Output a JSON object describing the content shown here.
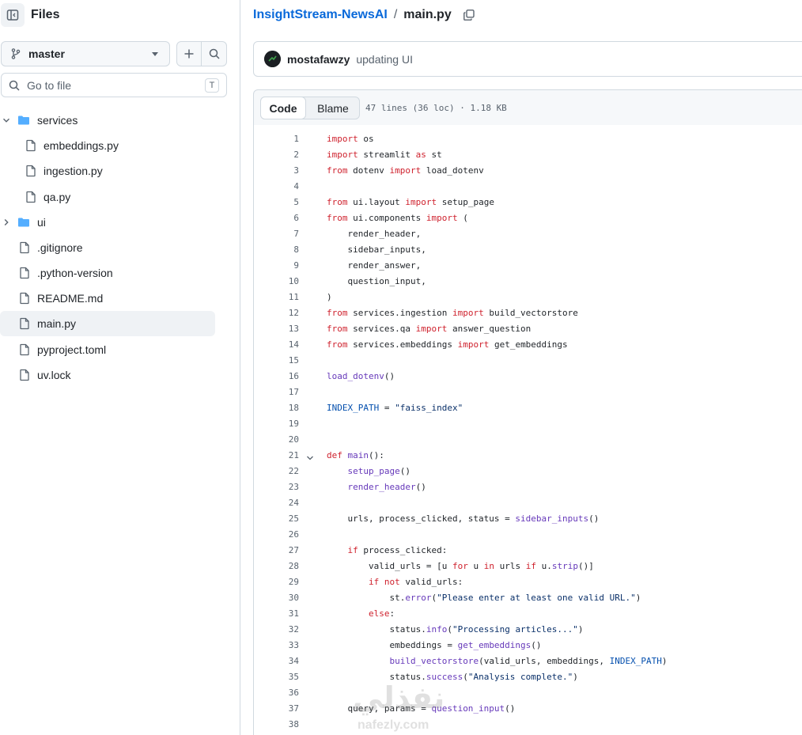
{
  "sidebar": {
    "title": "Files",
    "branch": "master",
    "search": {
      "placeholder": "Go to file",
      "shortcut": "T"
    },
    "tree": [
      {
        "name": "services",
        "type": "folder",
        "expanded": true,
        "depth": 0
      },
      {
        "name": "embeddings.py",
        "type": "file",
        "depth": 1
      },
      {
        "name": "ingestion.py",
        "type": "file",
        "depth": 1
      },
      {
        "name": "qa.py",
        "type": "file",
        "depth": 1
      },
      {
        "name": "ui",
        "type": "folder",
        "expanded": false,
        "depth": 0
      },
      {
        "name": ".gitignore",
        "type": "file",
        "depth": 0
      },
      {
        "name": ".python-version",
        "type": "file",
        "depth": 0
      },
      {
        "name": "README.md",
        "type": "file",
        "depth": 0
      },
      {
        "name": "main.py",
        "type": "file",
        "depth": 0,
        "selected": true
      },
      {
        "name": "pyproject.toml",
        "type": "file",
        "depth": 0
      },
      {
        "name": "uv.lock",
        "type": "file",
        "depth": 0
      }
    ]
  },
  "breadcrumb": {
    "repo": "InsightStream-NewsAI",
    "separator": "/",
    "file": "main.py"
  },
  "commit": {
    "author": "mostafawzy",
    "message": "updating UI"
  },
  "file_header": {
    "tab_code": "Code",
    "tab_blame": "Blame",
    "meta": "47 lines (36 loc) · 1.18 KB"
  },
  "code": [
    {
      "n": "1",
      "tokens": [
        [
          "k",
          "import"
        ],
        [
          "t",
          " os"
        ]
      ]
    },
    {
      "n": "2",
      "tokens": [
        [
          "k",
          "import"
        ],
        [
          "t",
          " streamlit "
        ],
        [
          "k",
          "as"
        ],
        [
          "t",
          " st"
        ]
      ]
    },
    {
      "n": "3",
      "tokens": [
        [
          "k",
          "from"
        ],
        [
          "t",
          " dotenv "
        ],
        [
          "k",
          "import"
        ],
        [
          "t",
          " load_dotenv"
        ]
      ]
    },
    {
      "n": "4",
      "tokens": []
    },
    {
      "n": "5",
      "tokens": [
        [
          "k",
          "from"
        ],
        [
          "t",
          " ui.layout "
        ],
        [
          "k",
          "import"
        ],
        [
          "t",
          " setup_page"
        ]
      ]
    },
    {
      "n": "6",
      "tokens": [
        [
          "k",
          "from"
        ],
        [
          "t",
          " ui.components "
        ],
        [
          "k",
          "import"
        ],
        [
          "t",
          " ("
        ]
      ]
    },
    {
      "n": "7",
      "tokens": [
        [
          "t",
          "    render_header,"
        ]
      ]
    },
    {
      "n": "8",
      "tokens": [
        [
          "t",
          "    sidebar_inputs,"
        ]
      ]
    },
    {
      "n": "9",
      "tokens": [
        [
          "t",
          "    render_answer,"
        ]
      ]
    },
    {
      "n": "10",
      "tokens": [
        [
          "t",
          "    question_input,"
        ]
      ]
    },
    {
      "n": "11",
      "tokens": [
        [
          "t",
          ")"
        ]
      ]
    },
    {
      "n": "12",
      "tokens": [
        [
          "k",
          "from"
        ],
        [
          "t",
          " services.ingestion "
        ],
        [
          "k",
          "import"
        ],
        [
          "t",
          " build_vectorstore"
        ]
      ]
    },
    {
      "n": "13",
      "tokens": [
        [
          "k",
          "from"
        ],
        [
          "t",
          " services.qa "
        ],
        [
          "k",
          "import"
        ],
        [
          "t",
          " answer_question"
        ]
      ]
    },
    {
      "n": "14",
      "tokens": [
        [
          "k",
          "from"
        ],
        [
          "t",
          " services.embeddings "
        ],
        [
          "k",
          "import"
        ],
        [
          "t",
          " get_embeddings"
        ]
      ]
    },
    {
      "n": "15",
      "tokens": []
    },
    {
      "n": "16",
      "tokens": [
        [
          "f",
          "load_dotenv"
        ],
        [
          "t",
          "()"
        ]
      ]
    },
    {
      "n": "17",
      "tokens": []
    },
    {
      "n": "18",
      "tokens": [
        [
          "c",
          "INDEX_PATH"
        ],
        [
          "t",
          " = "
        ],
        [
          "s",
          "\"faiss_index\""
        ]
      ]
    },
    {
      "n": "19",
      "tokens": []
    },
    {
      "n": "20",
      "tokens": []
    },
    {
      "n": "21",
      "fold": true,
      "tokens": [
        [
          "k",
          "def"
        ],
        [
          "t",
          " "
        ],
        [
          "f",
          "main"
        ],
        [
          "t",
          "():"
        ]
      ]
    },
    {
      "n": "22",
      "tokens": [
        [
          "t",
          "    "
        ],
        [
          "f",
          "setup_page"
        ],
        [
          "t",
          "()"
        ]
      ]
    },
    {
      "n": "23",
      "tokens": [
        [
          "t",
          "    "
        ],
        [
          "f",
          "render_header"
        ],
        [
          "t",
          "()"
        ]
      ]
    },
    {
      "n": "24",
      "tokens": []
    },
    {
      "n": "25",
      "tokens": [
        [
          "t",
          "    urls, process_clicked, status = "
        ],
        [
          "f",
          "sidebar_inputs"
        ],
        [
          "t",
          "()"
        ]
      ]
    },
    {
      "n": "26",
      "tokens": []
    },
    {
      "n": "27",
      "tokens": [
        [
          "t",
          "    "
        ],
        [
          "k",
          "if"
        ],
        [
          "t",
          " process_clicked:"
        ]
      ]
    },
    {
      "n": "28",
      "tokens": [
        [
          "t",
          "        valid_urls = [u "
        ],
        [
          "k",
          "for"
        ],
        [
          "t",
          " u "
        ],
        [
          "k",
          "in"
        ],
        [
          "t",
          " urls "
        ],
        [
          "k",
          "if"
        ],
        [
          "t",
          " u."
        ],
        [
          "f",
          "strip"
        ],
        [
          "t",
          "()]"
        ]
      ]
    },
    {
      "n": "29",
      "tokens": [
        [
          "t",
          "        "
        ],
        [
          "k",
          "if not"
        ],
        [
          "t",
          " valid_urls:"
        ]
      ]
    },
    {
      "n": "30",
      "tokens": [
        [
          "t",
          "            st."
        ],
        [
          "f",
          "error"
        ],
        [
          "t",
          "("
        ],
        [
          "s",
          "\"Please enter at least one valid URL.\""
        ],
        [
          "t",
          ")"
        ]
      ]
    },
    {
      "n": "31",
      "tokens": [
        [
          "t",
          "        "
        ],
        [
          "k",
          "else"
        ],
        [
          "t",
          ":"
        ]
      ]
    },
    {
      "n": "32",
      "tokens": [
        [
          "t",
          "            status."
        ],
        [
          "f",
          "info"
        ],
        [
          "t",
          "("
        ],
        [
          "s",
          "\"Processing articles...\""
        ],
        [
          "t",
          ")"
        ]
      ]
    },
    {
      "n": "33",
      "tokens": [
        [
          "t",
          "            embeddings = "
        ],
        [
          "f",
          "get_embeddings"
        ],
        [
          "t",
          "()"
        ]
      ]
    },
    {
      "n": "34",
      "tokens": [
        [
          "t",
          "            "
        ],
        [
          "f",
          "build_vectorstore"
        ],
        [
          "t",
          "(valid_urls, embeddings, "
        ],
        [
          "c",
          "INDEX_PATH"
        ],
        [
          "t",
          ")"
        ]
      ]
    },
    {
      "n": "35",
      "tokens": [
        [
          "t",
          "            status."
        ],
        [
          "f",
          "success"
        ],
        [
          "t",
          "("
        ],
        [
          "s",
          "\"Analysis complete.\""
        ],
        [
          "t",
          ")"
        ]
      ]
    },
    {
      "n": "36",
      "tokens": []
    },
    {
      "n": "37",
      "tokens": [
        [
          "t",
          "    query, params = "
        ],
        [
          "f",
          "question_input"
        ],
        [
          "t",
          "()"
        ]
      ]
    },
    {
      "n": "38",
      "tokens": []
    }
  ],
  "watermark": {
    "arabic": "نفذلي",
    "latin": "nafezly.com"
  },
  "colors": {
    "link": "#0969da",
    "keyword": "#cf222e",
    "function": "#6639ba",
    "constant": "#0550ae",
    "string": "#0a3069",
    "folder": "#54aeff"
  }
}
